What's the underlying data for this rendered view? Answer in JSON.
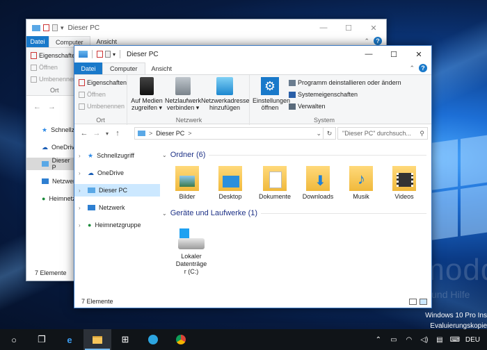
{
  "desktop": {
    "watermark": "Deskmodder.de",
    "watermark_sub": "News, Tipps und Hilfe",
    "edition_line1": "Windows 10 Pro Ins",
    "edition_line2": "Evaluierungskopie"
  },
  "back_window": {
    "title": "Dieser PC",
    "tab_file": "Datei",
    "tab_computer": "Computer",
    "tab_view": "Ansicht",
    "ribbon_items": [
      "Eigenschaften",
      "Öffnen",
      "Umbenennen"
    ],
    "group_label": "Ort",
    "nav_items": [
      "Schnellzugriff",
      "OneDrive",
      "Dieser P",
      "Netzwerk",
      "Heimnetz"
    ],
    "status": "7 Elemente"
  },
  "front_window": {
    "title": "Dieser PC",
    "tabs": {
      "file": "Datei",
      "computer": "Computer",
      "view": "Ansicht"
    },
    "ribbon": {
      "ort": {
        "label": "Ort",
        "properties": "Eigenschaften",
        "open": "Öffnen",
        "rename": "Umbenennen"
      },
      "netzwerk": {
        "label": "Netzwerk",
        "media_line1": "Auf Medien",
        "media_line2": "zugreifen",
        "netdrive_line1": "Netzlaufwerk",
        "netdrive_line2": "verbinden",
        "netaddr_line1": "Netzwerkadresse",
        "netaddr_line2": "hinzufügen"
      },
      "system": {
        "label": "System",
        "settings_line1": "Einstellungen",
        "settings_line2": "öffnen",
        "uninstall": "Programm deinstallieren oder ändern",
        "sysprops": "Systemeigenschaften",
        "manage": "Verwalten"
      }
    },
    "address": {
      "path": "Dieser PC",
      "sep": ">"
    },
    "search_placeholder": "\"Dieser PC\" durchsuch...",
    "nav": [
      {
        "label": "Schnellzugriff"
      },
      {
        "label": "OneDrive"
      },
      {
        "label": "Dieser PC"
      },
      {
        "label": "Netzwerk"
      },
      {
        "label": "Heimnetzgruppe"
      }
    ],
    "folders_header": "Ordner (6)",
    "folders": [
      {
        "label": "Bilder"
      },
      {
        "label": "Desktop"
      },
      {
        "label": "Dokumente"
      },
      {
        "label": "Downloads"
      },
      {
        "label": "Musik"
      },
      {
        "label": "Videos"
      }
    ],
    "drives_header": "Geräte und Laufwerke (1)",
    "drive": {
      "line1": "Lokaler",
      "line2": "Datenträge",
      "line3": "r (C:)"
    },
    "status": "7 Elemente"
  },
  "taskbar": {
    "language": "DEU"
  }
}
